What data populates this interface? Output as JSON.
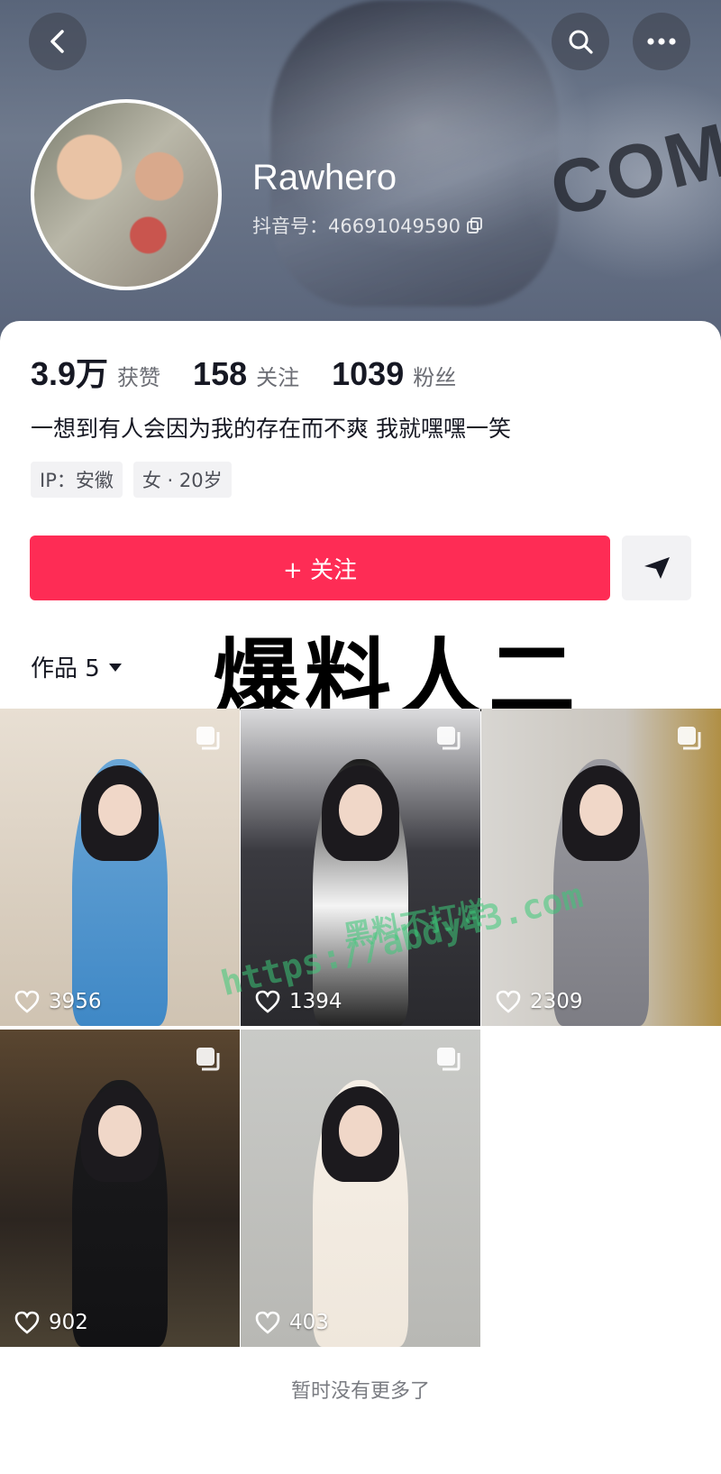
{
  "header": {
    "username": "Rawhero",
    "douyin_id": "抖音号：46691049590",
    "banner_text": "COM"
  },
  "stats": [
    {
      "value": "3.9万",
      "label": "获赞"
    },
    {
      "value": "158",
      "label": "关注"
    },
    {
      "value": "1039",
      "label": "粉丝"
    }
  ],
  "bio": "一想到有人会因为我的存在而不爽 我就嘿嘿一笑",
  "tags": [
    "IP：安徽",
    "女 · 20岁"
  ],
  "actions": {
    "follow_label": "+ 关注"
  },
  "works_tab": {
    "label": "作品 5"
  },
  "overlay_title": "爆料人二",
  "posts": [
    {
      "likes": "3956"
    },
    {
      "likes": "1394"
    },
    {
      "likes": "2309"
    },
    {
      "likes": "902"
    },
    {
      "likes": "403"
    }
  ],
  "watermark": {
    "line1": "黑料不打烊",
    "line2": "https://abdy43.com"
  },
  "footer_text": "暂时没有更多了",
  "colors": {
    "accent": "#fe2c55",
    "text_primary": "#161823",
    "text_secondary": "#6b6d74"
  },
  "icons": [
    "back-arrow-icon",
    "search-icon",
    "more-icon",
    "copy-icon",
    "share-send-icon",
    "dropdown-triangle-icon",
    "multi-image-icon",
    "heart-icon"
  ]
}
